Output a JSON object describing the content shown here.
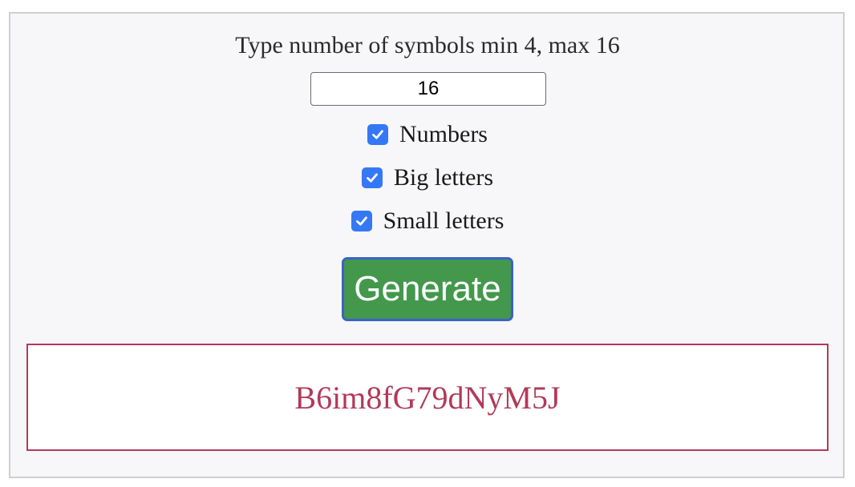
{
  "form": {
    "prompt": "Type number of symbols min 4, max 16",
    "length_value": "16",
    "options": [
      {
        "label": "Numbers",
        "checked": true
      },
      {
        "label": "Big letters",
        "checked": true
      },
      {
        "label": "Small letters",
        "checked": true
      }
    ],
    "generate_label": "Generate"
  },
  "result": {
    "password": "B6im8fG79dNyM5J"
  },
  "colors": {
    "checkbox": "#3478f6",
    "button_bg": "#43984c",
    "button_border": "#3a63c9",
    "result": "#b13a59",
    "panel_bg": "#f7f7f9"
  }
}
